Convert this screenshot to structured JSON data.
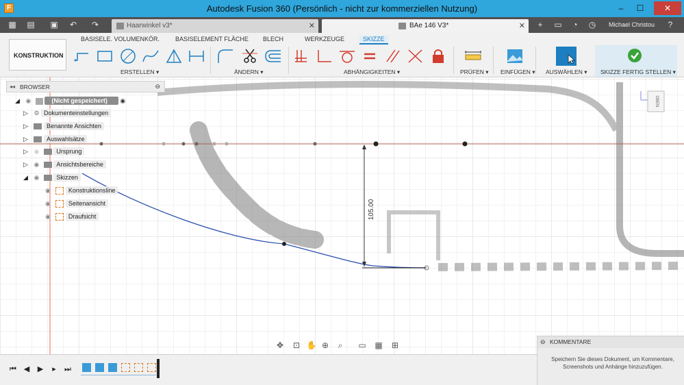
{
  "window": {
    "title": "Autodesk Fusion 360 (Persönlich - nicht zur kommerziellen Nutzung)",
    "app_icon_letter": "F",
    "minimize": "–",
    "maximize": "☐",
    "close": "✕"
  },
  "tabs": [
    {
      "label": "Haarwinkel v3*",
      "active": false
    },
    {
      "label": "BAe 146  V3*",
      "active": true
    }
  ],
  "user": {
    "name": "Michael Christou"
  },
  "ribbon": {
    "workspace": "KONSTRUKTION ▾",
    "tabs": [
      "BASISELE. VOLUMENKÖR.",
      "BASISELEMENT FLÄCHE",
      "BLECH",
      "WERKZEUGE",
      "SKIZZE"
    ],
    "active_tab": "SKIZZE",
    "groups": {
      "create": "ERSTELLEN ▾",
      "modify": "ÄNDERN ▾",
      "constraints": "ABHÄNGIGKEITEN ▾",
      "inspect": "PRÜFEN ▾",
      "insert": "EINFÜGEN ▾",
      "select": "AUSWÄHLEN ▾",
      "finish": "SKIZZE FERTIG STELLEN ▾"
    }
  },
  "browser": {
    "title": "BROWSER",
    "root": "(Nicht gespeichert)",
    "items": [
      {
        "label": "Dokumenteinstellungen"
      },
      {
        "label": "Benannte Ansichten"
      },
      {
        "label": "Auswahlsätze"
      },
      {
        "label": "Ursprung"
      },
      {
        "label": "Ansichtsbereiche"
      },
      {
        "label": "Skizzen"
      }
    ],
    "sketches": [
      {
        "label": "Konstruktionsline"
      },
      {
        "label": "Seitenansicht"
      },
      {
        "label": "Draufsicht"
      }
    ]
  },
  "canvas": {
    "dimension": "105.00",
    "viewcube_label": "OBEN"
  },
  "comments": {
    "title": "KOMMENTARE",
    "hint_line1": "Speichern Sie dieses Dokument, um Kommentare,",
    "hint_line2": "Screenshots und Anhänge hinzuzufügen."
  },
  "colors": {
    "titlebar": "#2fa6dc",
    "accent": "#1d7fc1",
    "sketch_curve": "#2a4fb0",
    "axis_line": "#b06050",
    "finish_check": "#3aa33a"
  }
}
